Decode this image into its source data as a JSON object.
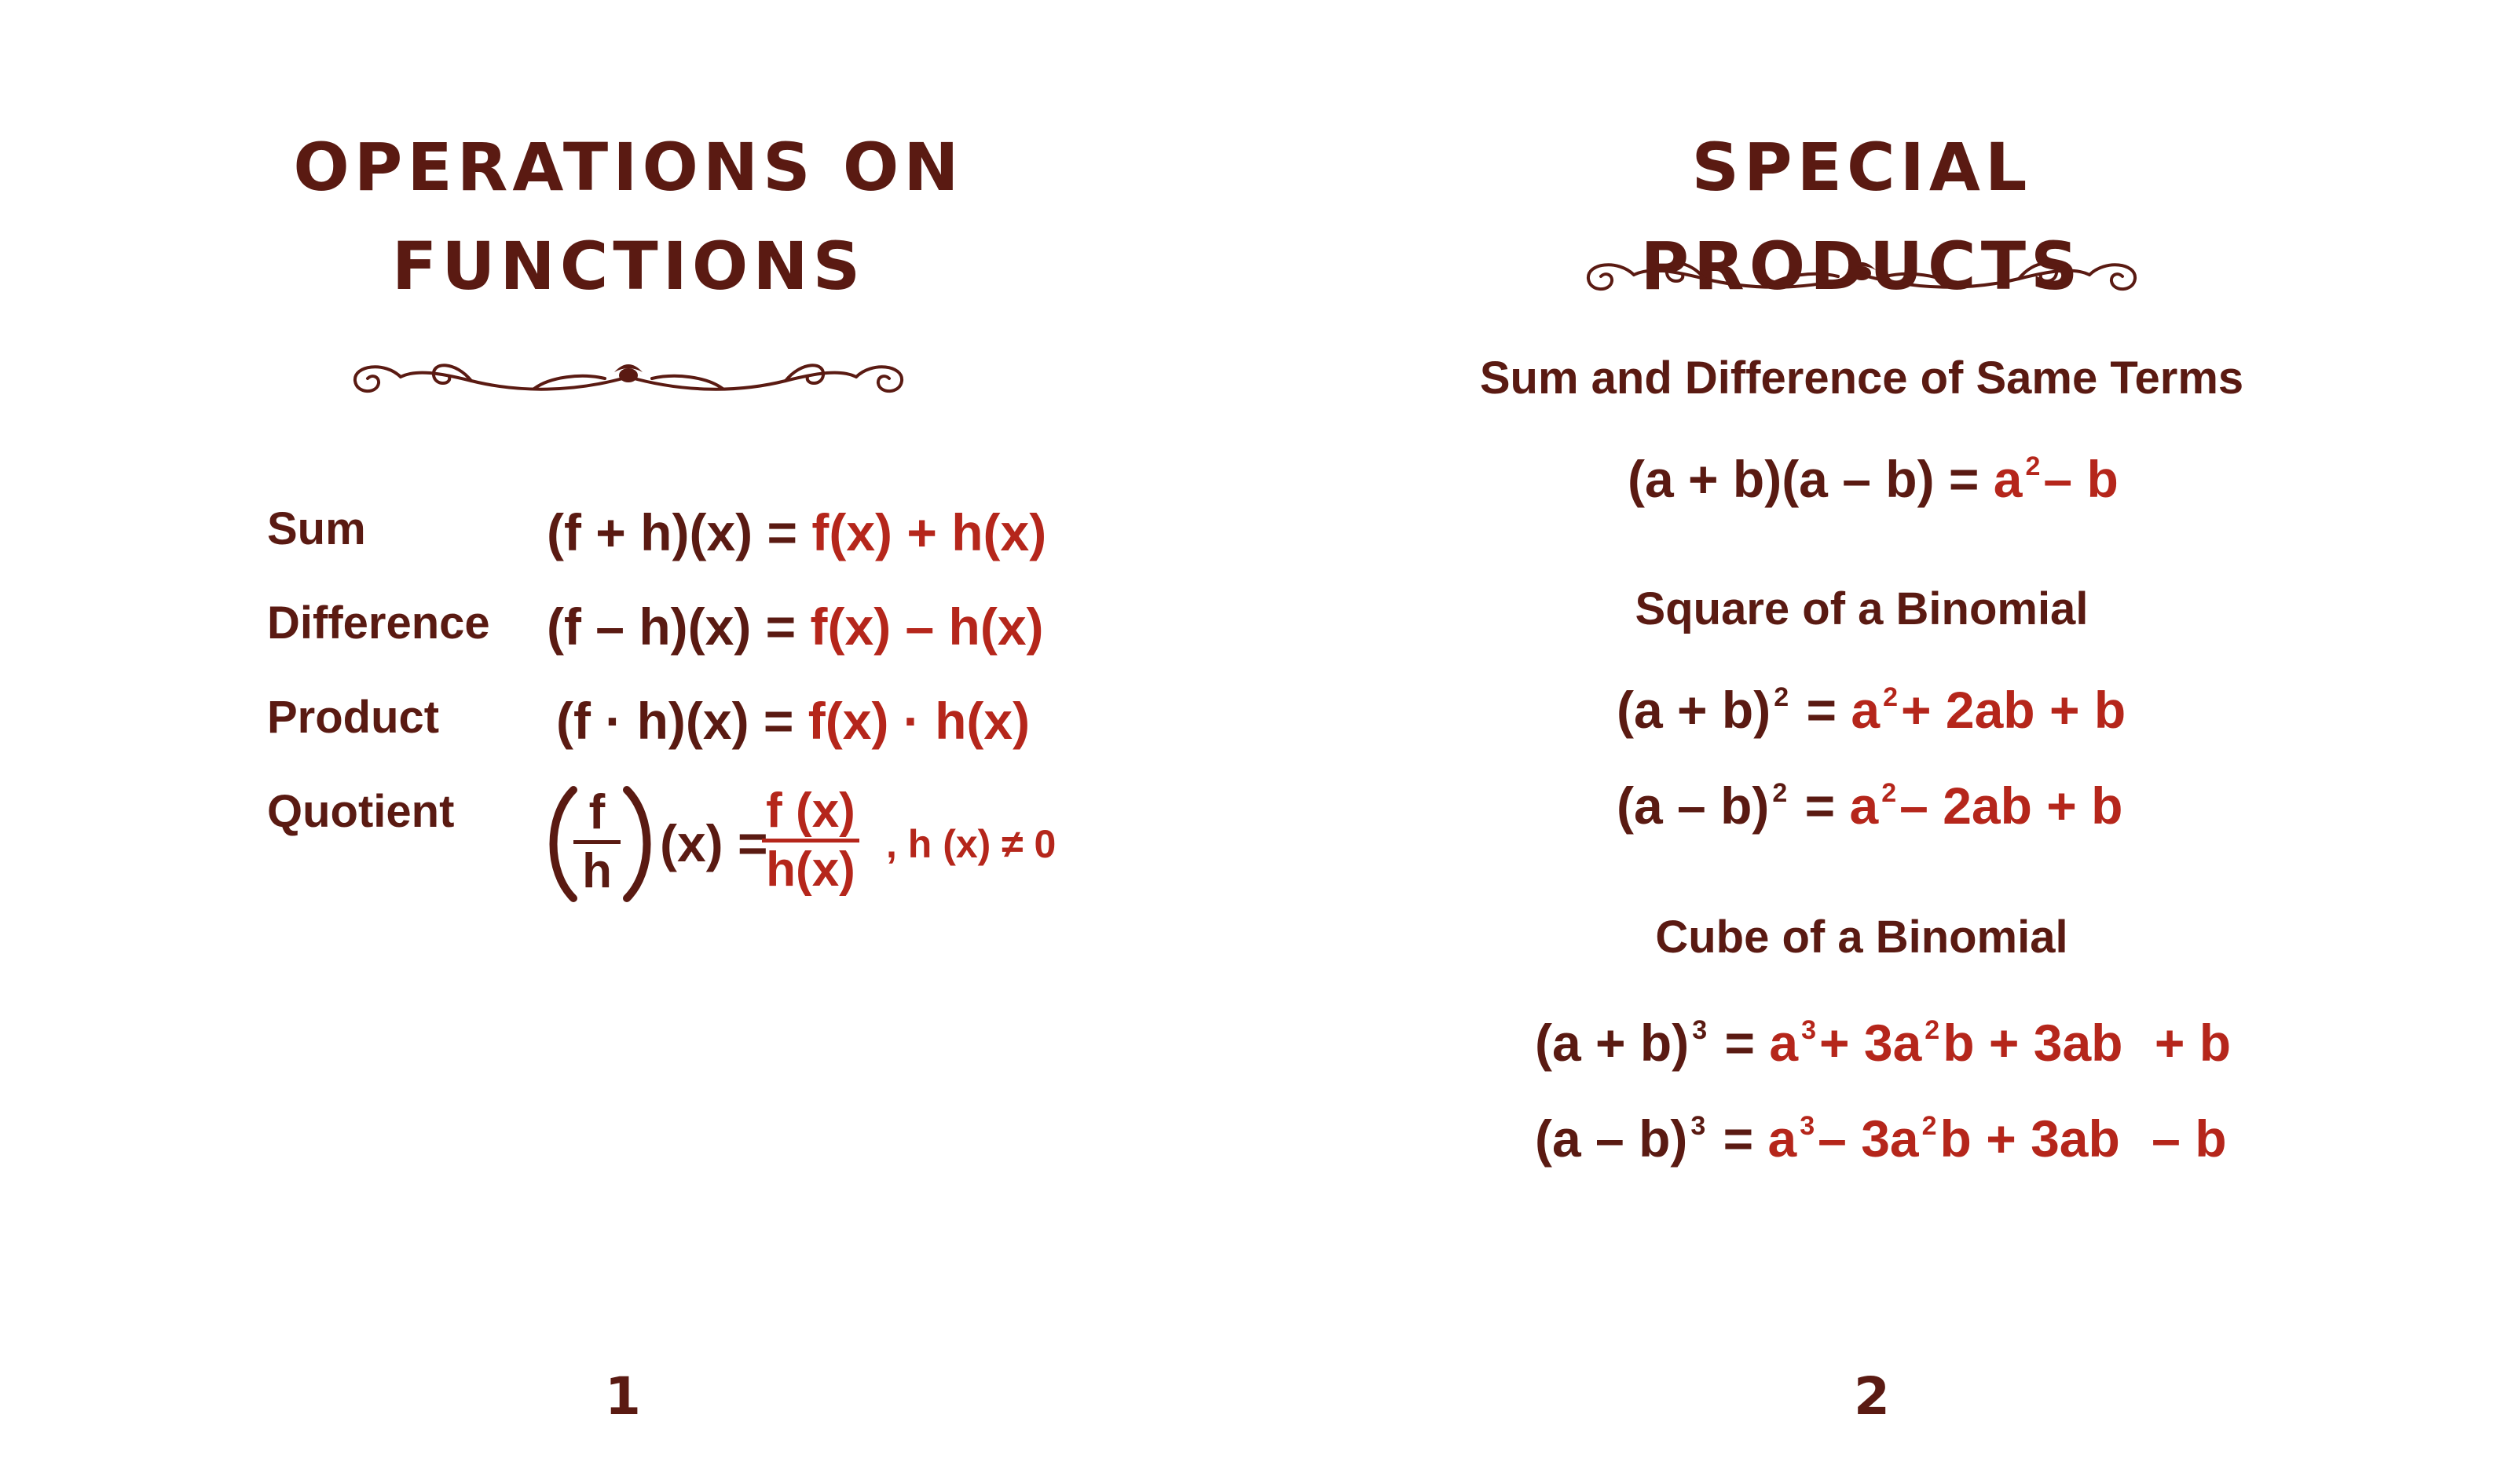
{
  "page1": {
    "title_line1": "OPERATIONS ON",
    "title_line2": "FUNCTIONS",
    "rows": [
      {
        "label": "Sum",
        "lhs": "(f + h)(x) =",
        "rhs": "f(x) + h(x)"
      },
      {
        "label": "Difference",
        "lhs": "(f – h)(x) =",
        "rhs": "f(x) – h(x)"
      },
      {
        "label": "Product",
        "lhs": "(f · h)(x) =",
        "rhs": "f(x) · h(x)"
      }
    ],
    "quotient": {
      "label": "Quotient",
      "num_left": "f",
      "den_left": "h",
      "mid": "(x) =",
      "num_right": "f (x)",
      "den_right": "h(x)",
      "condition": ", h (x) ≠ 0"
    },
    "page_number": "1"
  },
  "page2": {
    "title": "SPECIAL PRODUCTS",
    "sections": [
      {
        "heading": "Sum and Difference of Same Terms"
      },
      {
        "heading": "Square of a Binomial"
      },
      {
        "heading": "Cube of a Binomial"
      }
    ],
    "eq1": {
      "lhs": "(a + b)(a – b) =",
      "a": "a",
      "exp": "2",
      "rest": "– b"
    },
    "eq2": {
      "lhs": "(a + b)",
      "exp_l": "2",
      "eq": "=",
      "a": "a",
      "exp": "2",
      "rest": "+ 2ab + b"
    },
    "eq3": {
      "lhs": "(a – b)",
      "exp_l": "2",
      "eq": "=",
      "a": "a",
      "exp": "2",
      "rest": "– 2ab + b"
    },
    "eq4": {
      "lhs": "(a + b)",
      "exp_l": "3",
      "eq": "=",
      "a": "a",
      "exp": "3",
      "t2a": "+ 3a",
      "exp2": "2",
      "t2b": "b + 3ab",
      "rest": "+ b"
    },
    "eq5": {
      "lhs": "(a – b)",
      "exp_l": "3",
      "eq": "=",
      "a": "a",
      "exp": "3",
      "t2a": "– 3a",
      "exp2": "2",
      "t2b": "b + 3ab",
      "rest": "– b"
    },
    "page_number": "2"
  },
  "colors": {
    "dark": "#5a1a12",
    "accent": "#b5261b"
  }
}
